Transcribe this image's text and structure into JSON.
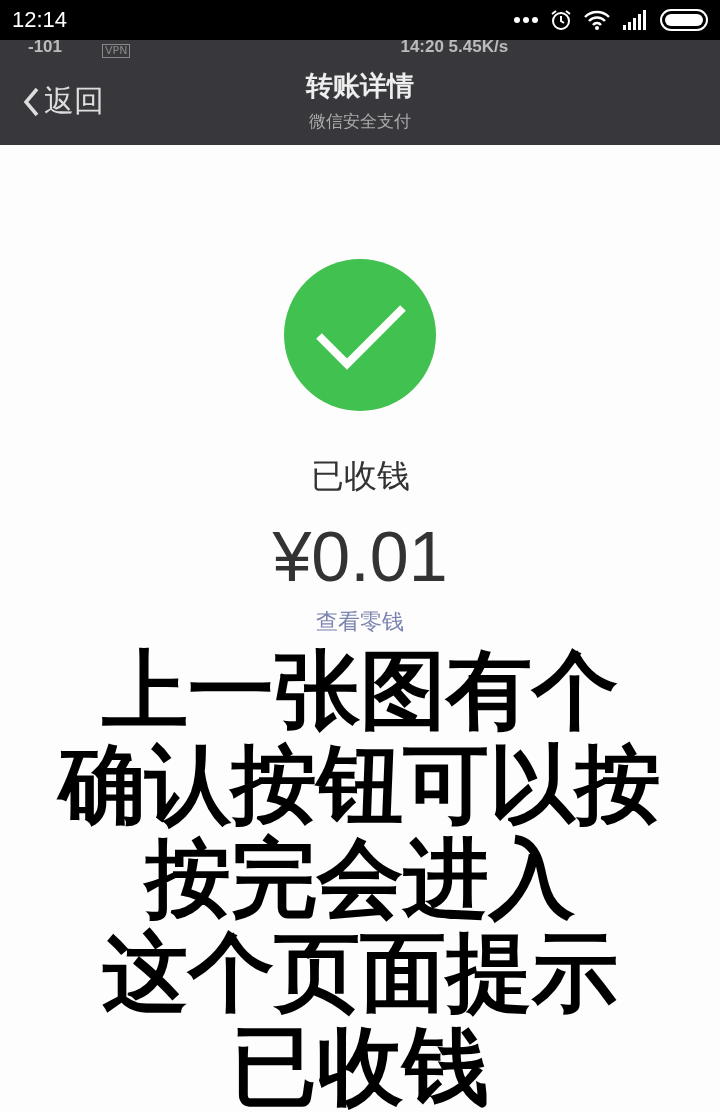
{
  "status_bar": {
    "time": "12:14"
  },
  "recorded_status_bar": {
    "signal": "-101",
    "vpn": "VPN",
    "center": "14:20 5.45K/s"
  },
  "nav_bar": {
    "back": "返回",
    "title": "转账详情",
    "subtitle": "微信安全支付"
  },
  "receipt": {
    "status": "已收钱",
    "amount": "¥0.01",
    "link": "查看零钱"
  },
  "caption": {
    "lines": [
      "上一张图有个",
      "确认按钮可以按",
      "按完会进入",
      "这个页面提示",
      "已收钱"
    ]
  }
}
